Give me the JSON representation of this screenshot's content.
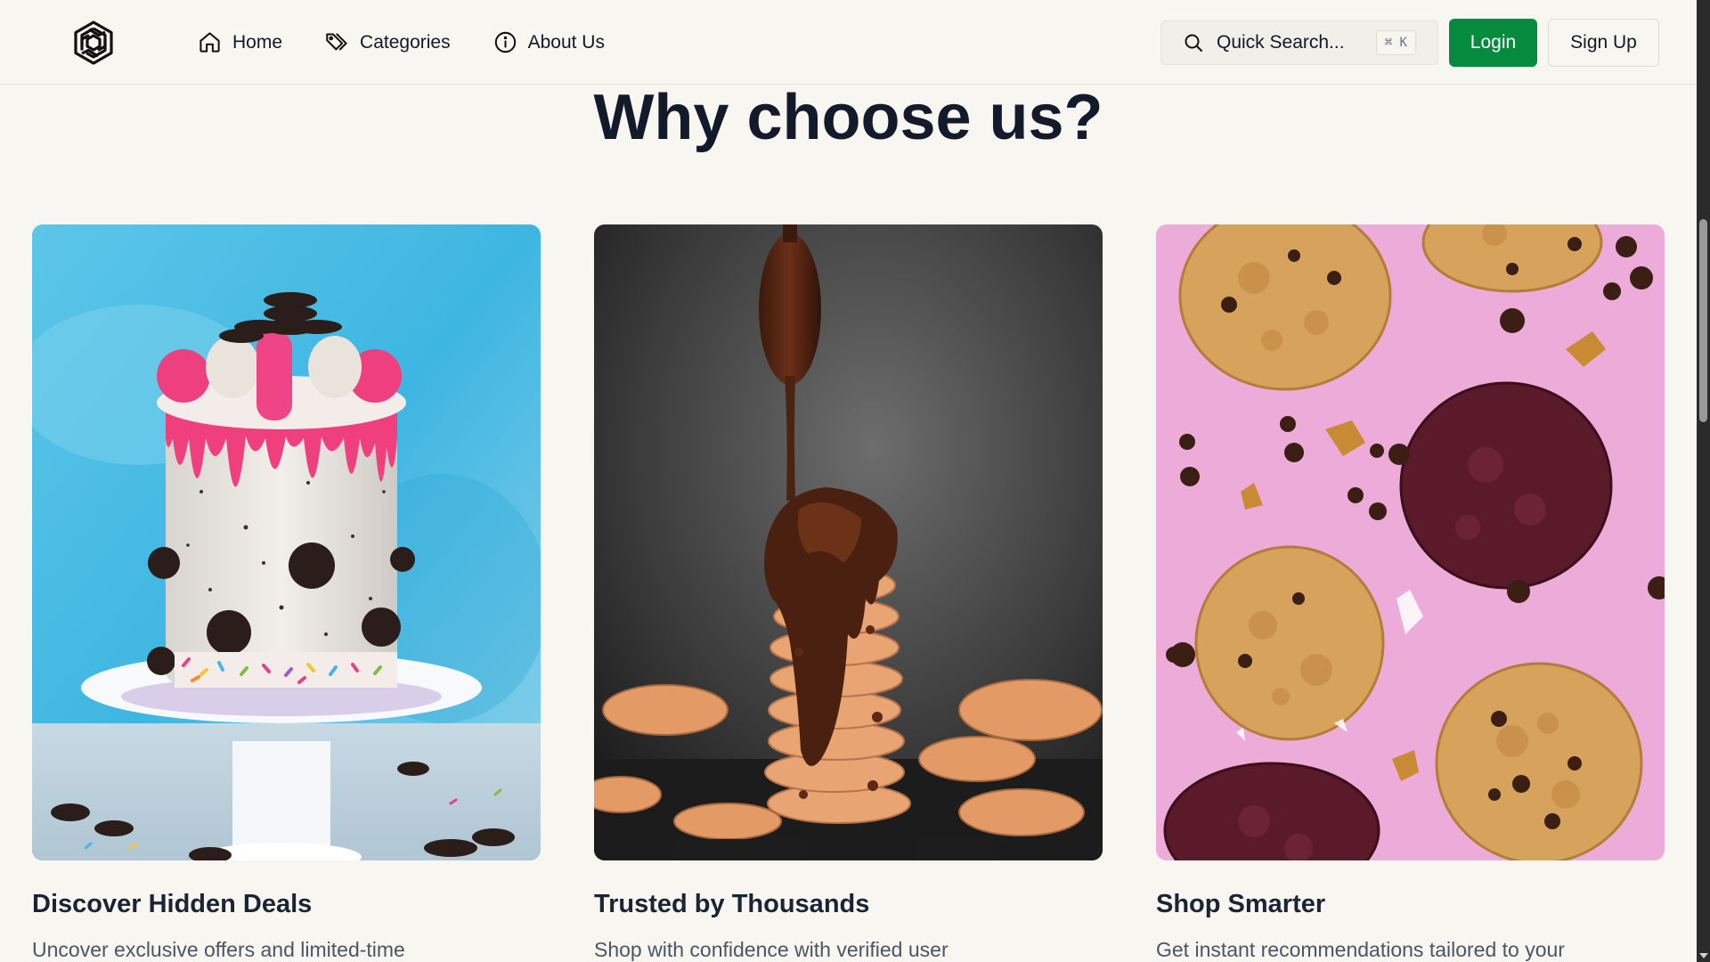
{
  "header": {
    "logo_icon": "openai-style-knot-logo",
    "nav": [
      {
        "label": "Home",
        "icon": "home-icon"
      },
      {
        "label": "Categories",
        "icon": "tag-icon"
      },
      {
        "label": "About Us",
        "icon": "info-icon"
      }
    ],
    "search": {
      "label": "Quick Search...",
      "shortcut": "⌘ K"
    },
    "login_label": "Login",
    "signup_label": "Sign Up"
  },
  "main": {
    "title": "Why choose us?",
    "cards": [
      {
        "title": "Discover Hidden Deals",
        "description": "Uncover exclusive offers and limited-time",
        "image": "cake-with-cookies-and-sprinkles"
      },
      {
        "title": "Trusted by Thousands",
        "description": "Shop with confidence with verified user",
        "image": "chocolate-pouring-on-cookie-stack"
      },
      {
        "title": "Shop Smarter",
        "description": "Get instant recommendations tailored to your",
        "image": "assorted-cookies-on-pink"
      }
    ]
  },
  "colors": {
    "background": "#f8f6f0",
    "login_button": "#058a3e",
    "heading": "#121a2c"
  }
}
